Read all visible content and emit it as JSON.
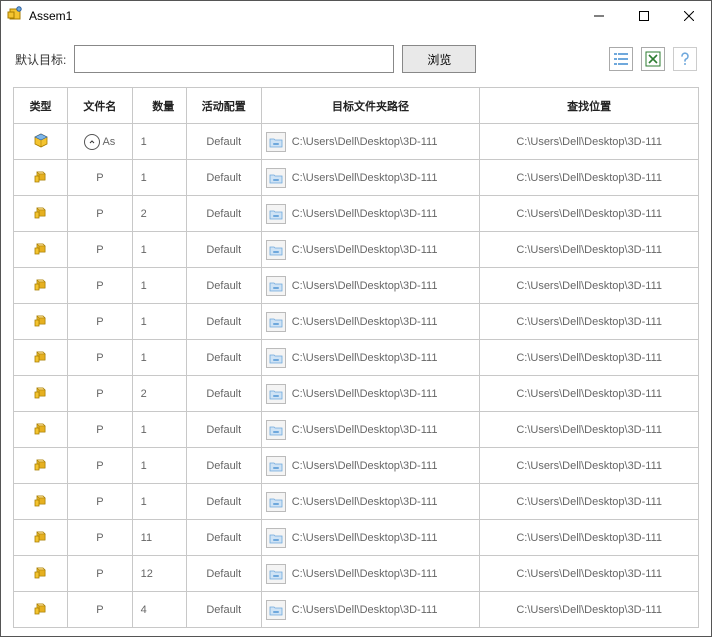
{
  "window": {
    "title": "Assem1"
  },
  "toolbar": {
    "target_label": "默认目标:",
    "target_value": "",
    "browse_label": "浏览"
  },
  "headers": {
    "type": "类型",
    "file": "文件名",
    "qty": "数量",
    "cfg": "活动配置",
    "path": "目标文件夹路径",
    "loc": "查找位置"
  },
  "rows": [
    {
      "kind": "assembly",
      "file": "As",
      "qty": "1",
      "cfg": "Default",
      "path": "C:\\Users\\Dell\\Desktop\\3D-111",
      "loc": "C:\\Users\\Dell\\Desktop\\3D-111"
    },
    {
      "kind": "part",
      "file": "P",
      "qty": "1",
      "cfg": "Default",
      "path": "C:\\Users\\Dell\\Desktop\\3D-111",
      "loc": "C:\\Users\\Dell\\Desktop\\3D-111"
    },
    {
      "kind": "part",
      "file": "P",
      "qty": "2",
      "cfg": "Default",
      "path": "C:\\Users\\Dell\\Desktop\\3D-111",
      "loc": "C:\\Users\\Dell\\Desktop\\3D-111"
    },
    {
      "kind": "part",
      "file": "P",
      "qty": "1",
      "cfg": "Default",
      "path": "C:\\Users\\Dell\\Desktop\\3D-111",
      "loc": "C:\\Users\\Dell\\Desktop\\3D-111"
    },
    {
      "kind": "part",
      "file": "P",
      "qty": "1",
      "cfg": "Default",
      "path": "C:\\Users\\Dell\\Desktop\\3D-111",
      "loc": "C:\\Users\\Dell\\Desktop\\3D-111"
    },
    {
      "kind": "part",
      "file": "P",
      "qty": "1",
      "cfg": "Default",
      "path": "C:\\Users\\Dell\\Desktop\\3D-111",
      "loc": "C:\\Users\\Dell\\Desktop\\3D-111"
    },
    {
      "kind": "part",
      "file": "P",
      "qty": "1",
      "cfg": "Default",
      "path": "C:\\Users\\Dell\\Desktop\\3D-111",
      "loc": "C:\\Users\\Dell\\Desktop\\3D-111"
    },
    {
      "kind": "part",
      "file": "P",
      "qty": "2",
      "cfg": "Default",
      "path": "C:\\Users\\Dell\\Desktop\\3D-111",
      "loc": "C:\\Users\\Dell\\Desktop\\3D-111"
    },
    {
      "kind": "part",
      "file": "P",
      "qty": "1",
      "cfg": "Default",
      "path": "C:\\Users\\Dell\\Desktop\\3D-111",
      "loc": "C:\\Users\\Dell\\Desktop\\3D-111"
    },
    {
      "kind": "part",
      "file": "P",
      "qty": "1",
      "cfg": "Default",
      "path": "C:\\Users\\Dell\\Desktop\\3D-111",
      "loc": "C:\\Users\\Dell\\Desktop\\3D-111"
    },
    {
      "kind": "part",
      "file": "P",
      "qty": "1",
      "cfg": "Default",
      "path": "C:\\Users\\Dell\\Desktop\\3D-111",
      "loc": "C:\\Users\\Dell\\Desktop\\3D-111"
    },
    {
      "kind": "part",
      "file": "P",
      "qty": "11",
      "cfg": "Default",
      "path": "C:\\Users\\Dell\\Desktop\\3D-111",
      "loc": "C:\\Users\\Dell\\Desktop\\3D-111"
    },
    {
      "kind": "part",
      "file": "P",
      "qty": "12",
      "cfg": "Default",
      "path": "C:\\Users\\Dell\\Desktop\\3D-111",
      "loc": "C:\\Users\\Dell\\Desktop\\3D-111"
    },
    {
      "kind": "part",
      "file": "P",
      "qty": "4",
      "cfg": "Default",
      "path": "C:\\Users\\Dell\\Desktop\\3D-111",
      "loc": "C:\\Users\\Dell\\Desktop\\3D-111"
    }
  ]
}
